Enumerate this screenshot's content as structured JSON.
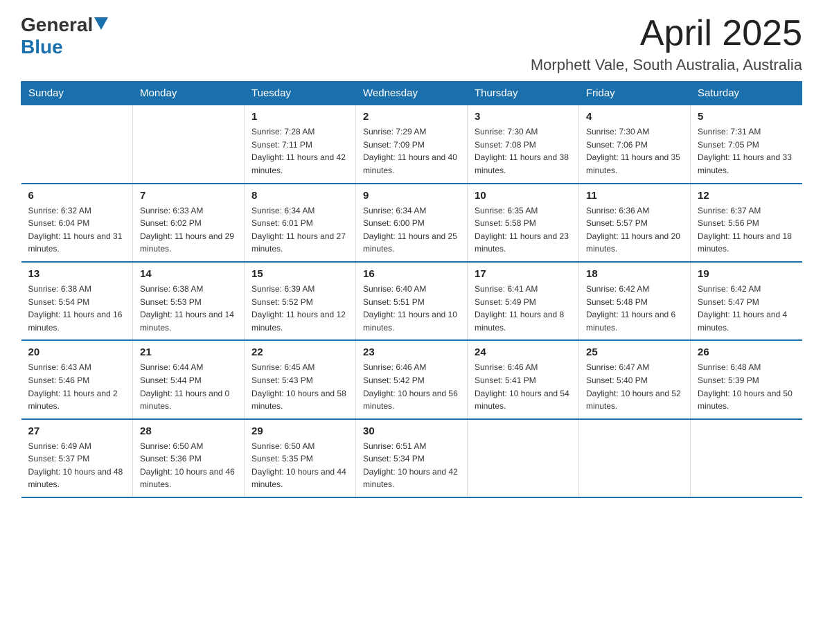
{
  "header": {
    "logo_general": "General",
    "logo_blue": "Blue",
    "month_title": "April 2025",
    "location": "Morphett Vale, South Australia, Australia"
  },
  "weekdays": [
    "Sunday",
    "Monday",
    "Tuesday",
    "Wednesday",
    "Thursday",
    "Friday",
    "Saturday"
  ],
  "weeks": [
    [
      {
        "day": "",
        "sunrise": "",
        "sunset": "",
        "daylight": ""
      },
      {
        "day": "",
        "sunrise": "",
        "sunset": "",
        "daylight": ""
      },
      {
        "day": "1",
        "sunrise": "Sunrise: 7:28 AM",
        "sunset": "Sunset: 7:11 PM",
        "daylight": "Daylight: 11 hours and 42 minutes."
      },
      {
        "day": "2",
        "sunrise": "Sunrise: 7:29 AM",
        "sunset": "Sunset: 7:09 PM",
        "daylight": "Daylight: 11 hours and 40 minutes."
      },
      {
        "day": "3",
        "sunrise": "Sunrise: 7:30 AM",
        "sunset": "Sunset: 7:08 PM",
        "daylight": "Daylight: 11 hours and 38 minutes."
      },
      {
        "day": "4",
        "sunrise": "Sunrise: 7:30 AM",
        "sunset": "Sunset: 7:06 PM",
        "daylight": "Daylight: 11 hours and 35 minutes."
      },
      {
        "day": "5",
        "sunrise": "Sunrise: 7:31 AM",
        "sunset": "Sunset: 7:05 PM",
        "daylight": "Daylight: 11 hours and 33 minutes."
      }
    ],
    [
      {
        "day": "6",
        "sunrise": "Sunrise: 6:32 AM",
        "sunset": "Sunset: 6:04 PM",
        "daylight": "Daylight: 11 hours and 31 minutes."
      },
      {
        "day": "7",
        "sunrise": "Sunrise: 6:33 AM",
        "sunset": "Sunset: 6:02 PM",
        "daylight": "Daylight: 11 hours and 29 minutes."
      },
      {
        "day": "8",
        "sunrise": "Sunrise: 6:34 AM",
        "sunset": "Sunset: 6:01 PM",
        "daylight": "Daylight: 11 hours and 27 minutes."
      },
      {
        "day": "9",
        "sunrise": "Sunrise: 6:34 AM",
        "sunset": "Sunset: 6:00 PM",
        "daylight": "Daylight: 11 hours and 25 minutes."
      },
      {
        "day": "10",
        "sunrise": "Sunrise: 6:35 AM",
        "sunset": "Sunset: 5:58 PM",
        "daylight": "Daylight: 11 hours and 23 minutes."
      },
      {
        "day": "11",
        "sunrise": "Sunrise: 6:36 AM",
        "sunset": "Sunset: 5:57 PM",
        "daylight": "Daylight: 11 hours and 20 minutes."
      },
      {
        "day": "12",
        "sunrise": "Sunrise: 6:37 AM",
        "sunset": "Sunset: 5:56 PM",
        "daylight": "Daylight: 11 hours and 18 minutes."
      }
    ],
    [
      {
        "day": "13",
        "sunrise": "Sunrise: 6:38 AM",
        "sunset": "Sunset: 5:54 PM",
        "daylight": "Daylight: 11 hours and 16 minutes."
      },
      {
        "day": "14",
        "sunrise": "Sunrise: 6:38 AM",
        "sunset": "Sunset: 5:53 PM",
        "daylight": "Daylight: 11 hours and 14 minutes."
      },
      {
        "day": "15",
        "sunrise": "Sunrise: 6:39 AM",
        "sunset": "Sunset: 5:52 PM",
        "daylight": "Daylight: 11 hours and 12 minutes."
      },
      {
        "day": "16",
        "sunrise": "Sunrise: 6:40 AM",
        "sunset": "Sunset: 5:51 PM",
        "daylight": "Daylight: 11 hours and 10 minutes."
      },
      {
        "day": "17",
        "sunrise": "Sunrise: 6:41 AM",
        "sunset": "Sunset: 5:49 PM",
        "daylight": "Daylight: 11 hours and 8 minutes."
      },
      {
        "day": "18",
        "sunrise": "Sunrise: 6:42 AM",
        "sunset": "Sunset: 5:48 PM",
        "daylight": "Daylight: 11 hours and 6 minutes."
      },
      {
        "day": "19",
        "sunrise": "Sunrise: 6:42 AM",
        "sunset": "Sunset: 5:47 PM",
        "daylight": "Daylight: 11 hours and 4 minutes."
      }
    ],
    [
      {
        "day": "20",
        "sunrise": "Sunrise: 6:43 AM",
        "sunset": "Sunset: 5:46 PM",
        "daylight": "Daylight: 11 hours and 2 minutes."
      },
      {
        "day": "21",
        "sunrise": "Sunrise: 6:44 AM",
        "sunset": "Sunset: 5:44 PM",
        "daylight": "Daylight: 11 hours and 0 minutes."
      },
      {
        "day": "22",
        "sunrise": "Sunrise: 6:45 AM",
        "sunset": "Sunset: 5:43 PM",
        "daylight": "Daylight: 10 hours and 58 minutes."
      },
      {
        "day": "23",
        "sunrise": "Sunrise: 6:46 AM",
        "sunset": "Sunset: 5:42 PM",
        "daylight": "Daylight: 10 hours and 56 minutes."
      },
      {
        "day": "24",
        "sunrise": "Sunrise: 6:46 AM",
        "sunset": "Sunset: 5:41 PM",
        "daylight": "Daylight: 10 hours and 54 minutes."
      },
      {
        "day": "25",
        "sunrise": "Sunrise: 6:47 AM",
        "sunset": "Sunset: 5:40 PM",
        "daylight": "Daylight: 10 hours and 52 minutes."
      },
      {
        "day": "26",
        "sunrise": "Sunrise: 6:48 AM",
        "sunset": "Sunset: 5:39 PM",
        "daylight": "Daylight: 10 hours and 50 minutes."
      }
    ],
    [
      {
        "day": "27",
        "sunrise": "Sunrise: 6:49 AM",
        "sunset": "Sunset: 5:37 PM",
        "daylight": "Daylight: 10 hours and 48 minutes."
      },
      {
        "day": "28",
        "sunrise": "Sunrise: 6:50 AM",
        "sunset": "Sunset: 5:36 PM",
        "daylight": "Daylight: 10 hours and 46 minutes."
      },
      {
        "day": "29",
        "sunrise": "Sunrise: 6:50 AM",
        "sunset": "Sunset: 5:35 PM",
        "daylight": "Daylight: 10 hours and 44 minutes."
      },
      {
        "day": "30",
        "sunrise": "Sunrise: 6:51 AM",
        "sunset": "Sunset: 5:34 PM",
        "daylight": "Daylight: 10 hours and 42 minutes."
      },
      {
        "day": "",
        "sunrise": "",
        "sunset": "",
        "daylight": ""
      },
      {
        "day": "",
        "sunrise": "",
        "sunset": "",
        "daylight": ""
      },
      {
        "day": "",
        "sunrise": "",
        "sunset": "",
        "daylight": ""
      }
    ]
  ]
}
